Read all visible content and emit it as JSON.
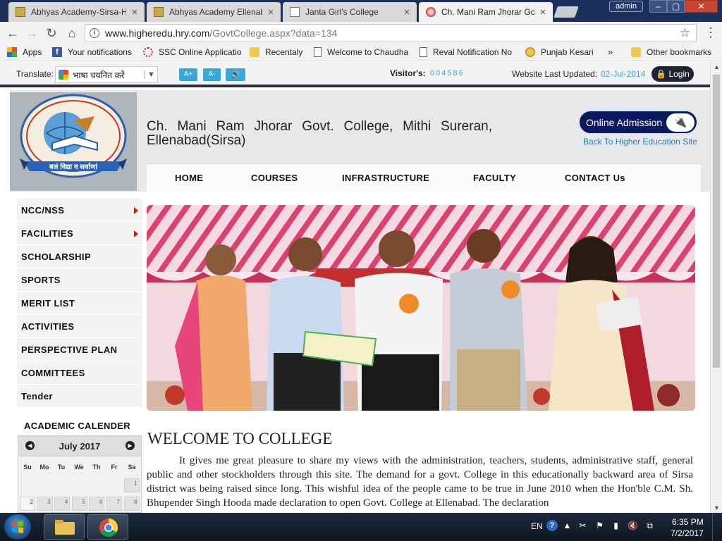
{
  "browser": {
    "tabs": [
      {
        "title": "Abhyas Academy-Sirsa-H",
        "favicon": "academy-favicon",
        "active": false
      },
      {
        "title": "Abhyas Academy Ellenab",
        "favicon": "academy-favicon",
        "active": false
      },
      {
        "title": "Janta Girl's College",
        "favicon": "page-icon",
        "active": false
      },
      {
        "title": "Ch. Mani Ram Jhorar Go",
        "favicon": "college-favicon",
        "active": true
      }
    ],
    "user_badge": "admin",
    "window_controls": {
      "minimize": "–",
      "maximize": "▢",
      "close": "✕"
    },
    "url_host": "www.higheredu.hry.com",
    "url_path": "/GovtCollege.aspx?data=134",
    "bookmarks": [
      {
        "label": "Apps",
        "icon": "apps-grid-icon"
      },
      {
        "label": "Your notifications",
        "icon": "facebook-icon"
      },
      {
        "label": "SSC Online Applicatio",
        "icon": "loading-icon"
      },
      {
        "label": "Recentaly",
        "icon": "folder-icon"
      },
      {
        "label": "Welcome to Chaudha",
        "icon": "page-icon"
      },
      {
        "label": "Reval Notification No",
        "icon": "page-icon"
      },
      {
        "label": "Punjab Kesari",
        "icon": "punjab-kesari-icon"
      }
    ],
    "bookmarks_more": "»",
    "other_bookmarks": "Other bookmarks"
  },
  "site": {
    "translate_label": "Translate:",
    "translate_select": "भाषा चयनित करें",
    "font_increase": "A+",
    "font_decrease": "A-",
    "visitors_label": "Visitor's:",
    "visitors_count": "004586",
    "updated_label": "Website Last Updated:",
    "updated_date": "02-Jul-2014",
    "login_label": "Login",
    "logo_motto": "बलं विद्या व सर्वाणां",
    "college_name": "Ch. Mani Ram Jhorar Govt. College, Mithi Sureran, Ellenabad(Sirsa)",
    "online_admission": "Online Admission",
    "back_link": "Back To Higher Education Site",
    "nav": [
      "HOME",
      "COURSES",
      "INFRASTRUCTURE",
      "FACULTY",
      "CONTACT Us"
    ],
    "sidebar": [
      {
        "label": "NCC/NSS",
        "has_submenu": true
      },
      {
        "label": "FACILITIES",
        "has_submenu": true
      },
      {
        "label": "SCHOLARSHIP",
        "has_submenu": false
      },
      {
        "label": "SPORTS",
        "has_submenu": false
      },
      {
        "label": "MERIT LIST",
        "has_submenu": false
      },
      {
        "label": "ACTIVITIES",
        "has_submenu": false
      },
      {
        "label": "PERSPECTIVE PLAN",
        "has_submenu": false
      },
      {
        "label": "COMMITTEES",
        "has_submenu": false
      },
      {
        "label": "Tender",
        "has_submenu": false
      }
    ],
    "calendar": {
      "title": "ACADEMIC CALENDER",
      "month": "July 2017",
      "weekdays": [
        "Su",
        "Mo",
        "Tu",
        "We",
        "Th",
        "Fr",
        "Sa"
      ],
      "first_row": [
        "",
        "",
        "",
        "",
        "",
        "",
        "1"
      ],
      "second_row": [
        "2",
        "3",
        "4",
        "5",
        "6",
        "7",
        "8"
      ],
      "today": "2"
    },
    "welcome_title": "WELCOME TO COLLEGE",
    "welcome_text": "It gives me great pleasure to share my views with the administration, teachers, students, administrative staff, general public and other stockholders through this site. The demand for a govt. College in this educationally backward area of Sirsa district was being raised since long. This wishful idea of the people came to be true in June 2010 when the Hon'ble C.M. Sh. Bhupender Singh Hooda made declaration to open Govt. College at Ellenabad. The declaration"
  },
  "taskbar": {
    "language": "EN",
    "time": "6:35 PM",
    "date": "7/2/2017"
  },
  "colors": {
    "tabbar": "#1b2f5a",
    "accent_blue": "#3ba7d8",
    "admission_bg": "#0b1a5e",
    "submenu_arrow": "#c02018"
  }
}
